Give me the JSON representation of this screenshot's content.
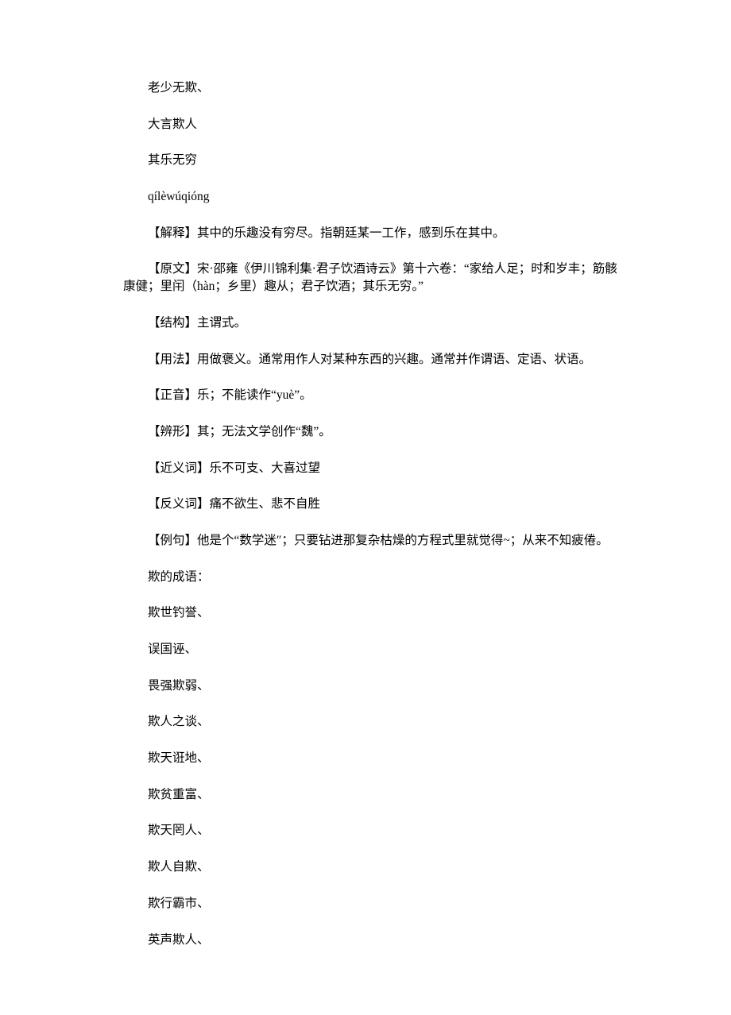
{
  "lines": [
    "老少无欺、",
    "大言欺人",
    "其乐无穷",
    "qílèwúqióng",
    "【解释】其中的乐趣没有穷尽。指朝廷某一工作，感到乐在其中。",
    "【原文】宋·邵雍《伊川锦利集·君子饮酒诗云》第十六卷：“家给人足；时和岁丰；筋骸康健；里闬（hàn；乡里）趣从；君子饮酒；其乐无穷。”",
    "【结构】主谓式。",
    "【用法】用做褒义。通常用作人对某种东西的兴趣。通常并作谓语、定语、状语。",
    "【正音】乐；不能读作“yuè”。",
    "【辨形】其；无法文学创作“魏”。",
    "【近义词】乐不可支、大喜过望",
    "【反义词】痛不欲生、悲不自胜",
    "【例句】他是个“数学迷″；只要钻进那复杂枯燥的方程式里就觉得~；从来不知疲倦。",
    "欺的成语：",
    "欺世钓誉、",
    "误国诬、",
    "畏强欺弱、",
    "欺人之谈、",
    "欺天诳地、",
    "欺贫重富、",
    "欺天罔人、",
    "欺人自欺、",
    "欺行霸市、",
    "英声欺人、"
  ]
}
